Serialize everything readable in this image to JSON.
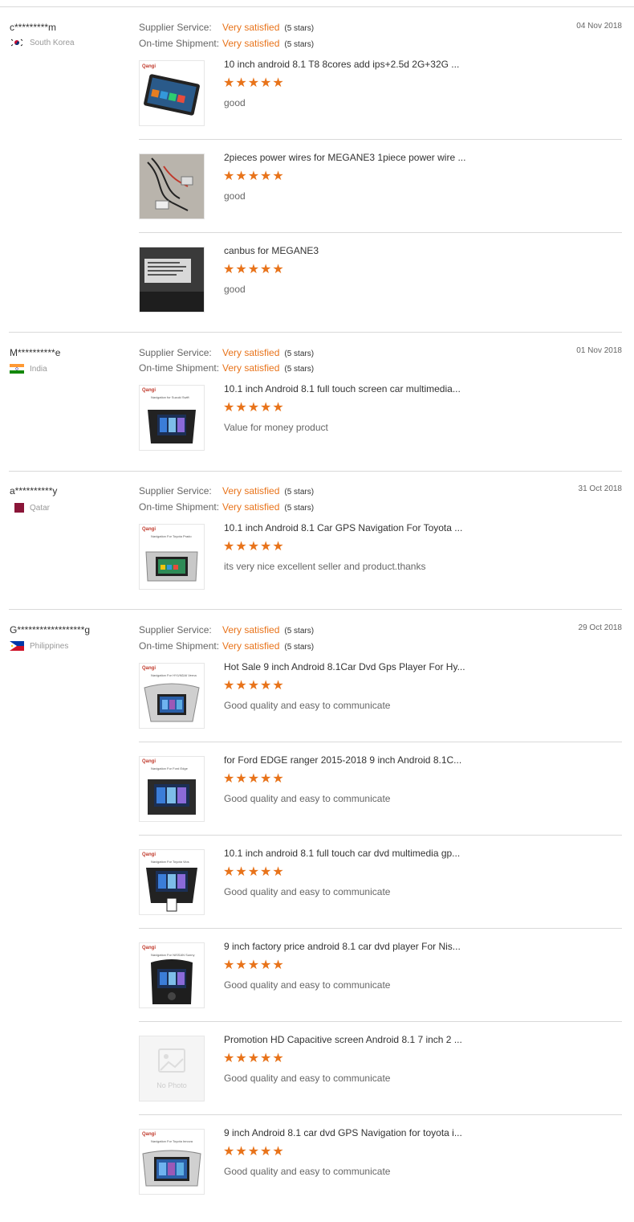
{
  "reviews": [
    {
      "buyer": "c*********m",
      "country": "South Korea",
      "flag": "kr",
      "date": "04 Nov 2018",
      "supplier_label": "Supplier Service:",
      "supplier_value": "Very satisfied",
      "supplier_stars": "(5 stars)",
      "shipment_label": "On-time Shipment:",
      "shipment_value": "Very satisfied",
      "shipment_stars": "(5 stars)",
      "items": [
        {
          "title": "10 inch android 8.1 T8 8cores add ips+2.5d 2G+32G ...",
          "stars": "★★★★★",
          "rating": 5,
          "comment": "good",
          "thumb": "car-screen"
        },
        {
          "title": "2pieces power wires for MEGANE3 1piece power wire ...",
          "stars": "★★★★★",
          "rating": 5,
          "comment": "good",
          "thumb": "wires"
        },
        {
          "title": "canbus for MEGANE3",
          "stars": "★★★★★",
          "rating": 5,
          "comment": "good",
          "thumb": "canbus"
        }
      ]
    },
    {
      "buyer": "M**********e",
      "country": "India",
      "flag": "in",
      "date": "01 Nov 2018",
      "supplier_label": "Supplier Service:",
      "supplier_value": "Very satisfied",
      "supplier_stars": "(5 stars)",
      "shipment_label": "On-time Shipment:",
      "shipment_value": "Very satisfied",
      "shipment_stars": "(5 stars)",
      "items": [
        {
          "title": "10.1 inch Android 8.1 full touch screen car multimedia...",
          "stars": "★★★★★",
          "rating": 5,
          "comment": "Value for money product",
          "thumb": "dash",
          "brand": "Qangi",
          "caption": "Navigation for Suzuki Swift"
        }
      ]
    },
    {
      "buyer": "a**********y",
      "country": "Qatar",
      "flag": "qa",
      "date": "31 Oct 2018",
      "supplier_label": "Supplier Service:",
      "supplier_value": "Very satisfied",
      "supplier_stars": "(5 stars)",
      "shipment_label": "On-time Shipment:",
      "shipment_value": "Very satisfied",
      "shipment_stars": "(5 stars)",
      "items": [
        {
          "title": "10.1 inch Android 8.1 Car GPS Navigation For Toyota ...",
          "stars": "★★★★★",
          "rating": 5,
          "comment": "its very nice excellent seller and product.thanks",
          "thumb": "dash-silver",
          "brand": "Qangi",
          "caption": "Navigation For Toyota Prado"
        }
      ]
    },
    {
      "buyer": "G******************g",
      "country": "Philippines",
      "flag": "ph",
      "date": "29 Oct 2018",
      "supplier_label": "Supplier Service:",
      "supplier_value": "Very satisfied",
      "supplier_stars": "(5 stars)",
      "shipment_label": "On-time Shipment:",
      "shipment_value": "Very satisfied",
      "shipment_stars": "(5 stars)",
      "items": [
        {
          "title": "Hot Sale 9 inch Android 8.1Car Dvd Gps Player For Hy...",
          "stars": "★★★★★",
          "rating": 5,
          "comment": "Good quality and easy to communicate",
          "thumb": "dash-silver",
          "brand": "Qangi",
          "caption": "Navigation For HYUNDAI Verna"
        },
        {
          "title": "for Ford EDGE ranger 2015-2018 9 inch Android 8.1C...",
          "stars": "★★★★★",
          "rating": 5,
          "comment": "Good quality and easy to communicate",
          "thumb": "dash",
          "brand": "Qangi",
          "caption": "Navigation For Ford Edge"
        },
        {
          "title": "10.1 inch android 8.1 full touch car dvd multimedia gp...",
          "stars": "★★★★★",
          "rating": 5,
          "comment": "Good quality and easy to communicate",
          "thumb": "dash",
          "brand": "Qangi",
          "caption": "Navigation For Toyota Vios"
        },
        {
          "title": "9 inch factory price android 8.1 car dvd player For Nis...",
          "stars": "★★★★★",
          "rating": 5,
          "comment": "Good quality and easy to communicate",
          "thumb": "dash",
          "brand": "Qangi",
          "caption": "Navigation For NISSAN Sunny"
        },
        {
          "title": "Promotion HD Capacitive screen Android 8.1 7 inch 2 ...",
          "stars": "★★★★★",
          "rating": 5,
          "comment": "Good quality and easy to communicate",
          "thumb": "nophoto",
          "nophoto_label": "No Photo"
        },
        {
          "title": "9 inch Android 8.1 car dvd GPS Navigation for toyota i...",
          "stars": "★★★★★",
          "rating": 5,
          "comment": "Good quality and easy to communicate",
          "thumb": "dash-silver",
          "brand": "Qangi",
          "caption": "Navigation For Toyota Innova"
        }
      ]
    }
  ],
  "colors": {
    "accent": "#e8731a",
    "divider": "#d9d9d9",
    "muted": "#999999"
  }
}
